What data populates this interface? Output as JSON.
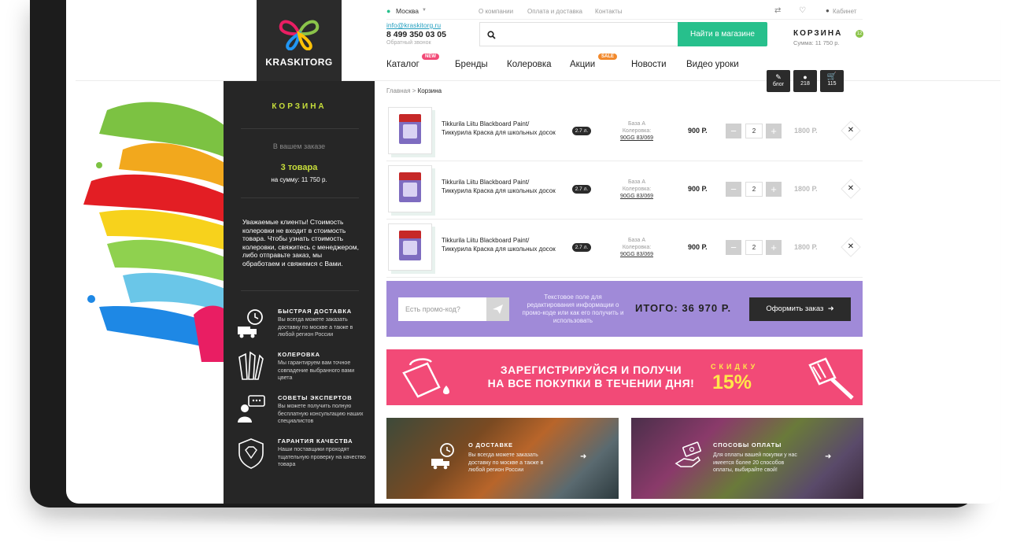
{
  "header": {
    "city": "Москва",
    "top_links": [
      "О компании",
      "Оплата и доставка",
      "Контакты"
    ],
    "email": "info@kraskitorg.ru",
    "phone": "8 499 350 03 05",
    "callback": "Обратный звонок",
    "cabinet": "Кабинет",
    "search_button": "Найти в магазине",
    "cart_label": "КОРЗИНА",
    "cart_count": "12",
    "cart_sum": "Сумма: 11 750 р."
  },
  "logo": {
    "text": "KRASKITORG"
  },
  "nav": [
    {
      "label": "Каталог",
      "badge": "NEW"
    },
    {
      "label": "Бренды"
    },
    {
      "label": "Колеровка"
    },
    {
      "label": "Акции",
      "badge": "SALE"
    },
    {
      "label": "Новости"
    },
    {
      "label": "Видео уроки"
    }
  ],
  "floating": [
    {
      "label": "блог"
    },
    {
      "label": "218"
    },
    {
      "label": "115"
    }
  ],
  "breadcrumb": {
    "home": "Главная",
    "sep": ">",
    "current": "Корзина"
  },
  "sidebar": {
    "title": "КОРЗИНА",
    "in_order": "В вашем заказе",
    "count": "3 товара",
    "sum": "на сумму: 11 750 р.",
    "note": "Уважаемые клиенты! Стоимость колеровки не входит в стоимость товара. Чтобы узнать стоимость колеровки, свяжитесь с менеджером, либо отправьте заказ, мы обработаем и свяжемся с Вами.",
    "features": [
      {
        "title": "БЫСТРАЯ ДОСТАВКА",
        "text": "Вы всегда можете заказать доставку по москве а также в любой регион России",
        "icon": "truck-clock-icon"
      },
      {
        "title": "КОЛЕРОВКА",
        "text": "Мы гарантируем вам точное совпадение выбранного вами цвета",
        "icon": "brushes-icon"
      },
      {
        "title": "СОВЕТЫ ЭКСПЕРТОВ",
        "text": "Вы можете получить полную бесплатную консультацию наших специалистов",
        "icon": "expert-chat-icon"
      },
      {
        "title": "ГАРАНТИЯ КАЧЕСТВА",
        "text": "Наши поставщики проходят тщательную проверку на качество товара",
        "icon": "diamond-shield-icon"
      }
    ]
  },
  "cart_items": [
    {
      "name": "Tikkurila Liitu Blackboard Paint/ Тиккурила Краска для школьных досок",
      "volume": "2.7 л.",
      "base": "База А",
      "color_label": "Колеровка:",
      "color": "90GG 83/069",
      "price": "900 Р.",
      "qty": "2",
      "total": "1800 Р."
    },
    {
      "name": "Tikkurila Liitu Blackboard Paint/ Тиккурила Краска для школьных досок",
      "volume": "2.7 л.",
      "base": "База А",
      "color_label": "Колеровка:",
      "color": "90GG 83/069",
      "price": "900 Р.",
      "qty": "2",
      "total": "1800 Р."
    },
    {
      "name": "Tikkurila Liitu Blackboard Paint/ Тиккурила Краска для школьных досок",
      "volume": "2.7 л.",
      "base": "База А",
      "color_label": "Колеровка:",
      "color": "90GG 83/069",
      "price": "900 Р.",
      "qty": "2",
      "total": "1800 Р."
    }
  ],
  "promo": {
    "placeholder": "Есть промо-код?",
    "text": "Текстовое поле для редактирования информации о промо-коде или как его получить и использовать",
    "total_label": "ИТОГО:",
    "total_value": "36 970 Р.",
    "order_button": "Оформить заказ"
  },
  "banner": {
    "line1": "ЗАРЕГИСТРИРУЙСЯ И ПОЛУЧИ",
    "line2": "НА ВСЕ ПОКУПКИ В ТЕЧЕНИИ ДНЯ!",
    "discount_label": "СКИДКУ",
    "discount_value": "15%"
  },
  "tiles": [
    {
      "title": "О ДОСТАВКЕ",
      "text": "Вы всегда можете заказать доставку по москве а также в любой регион России"
    },
    {
      "title": "СПОСОБЫ ОПЛАТЫ",
      "text": "Для оплаты вашей покупки у нас имеется более 20 способов оплаты, выбирайте свой!"
    }
  ],
  "colors": {
    "accent_green": "#27c08c",
    "lime": "#c8df3b",
    "promo_purple": "#a08ad8",
    "banner_pink": "#f24a77",
    "dark": "#262626"
  }
}
